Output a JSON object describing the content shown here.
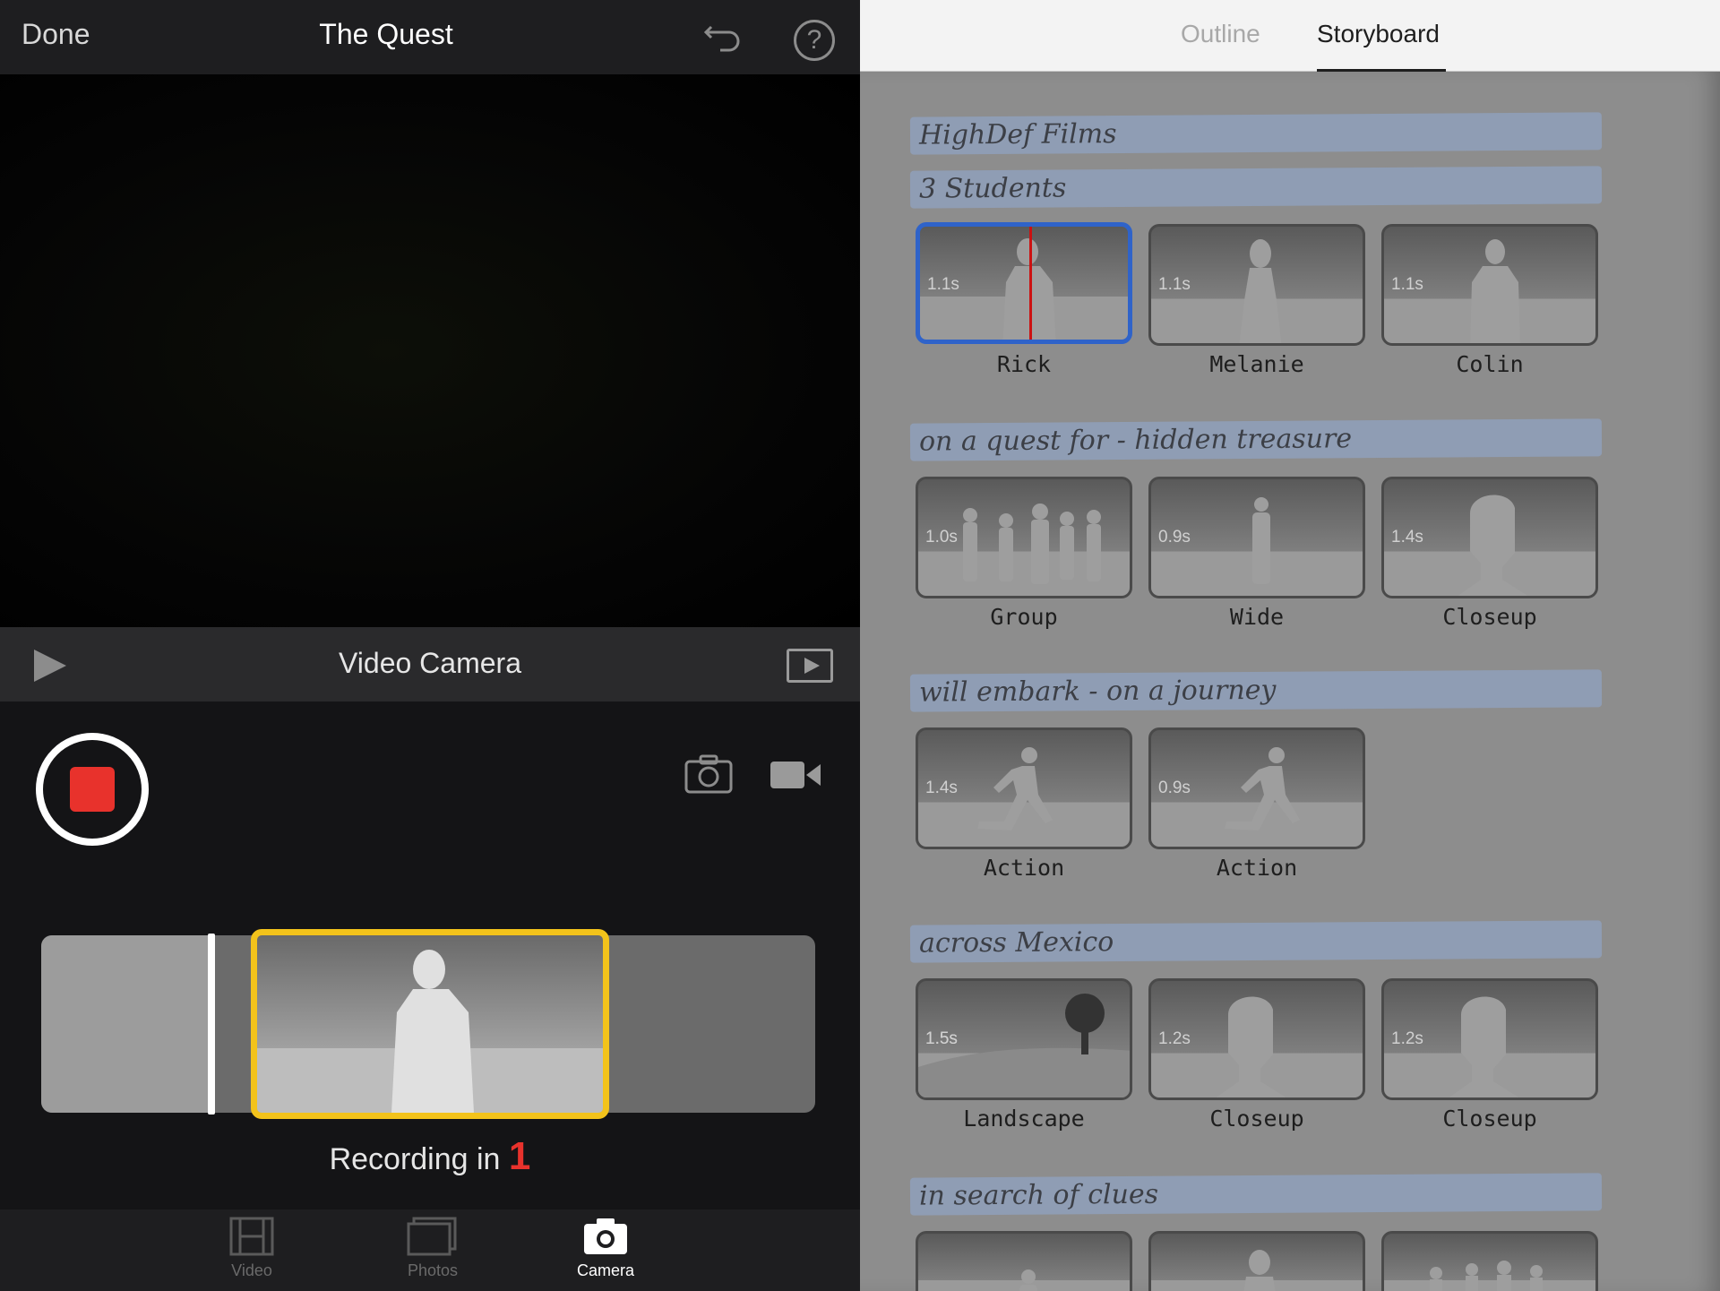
{
  "editor": {
    "done_label": "Done",
    "title": "The Quest",
    "undo_icon": "undo-arrow",
    "help_glyph": "?"
  },
  "camera_bar": {
    "label": "Video Camera"
  },
  "recording": {
    "prefix": "Recording in ",
    "countdown": "1",
    "accent": "#e8322c"
  },
  "clip_strip": {
    "highlight_color": "#f3c31b"
  },
  "tabs": [
    {
      "label": "Video",
      "icon": "film-icon",
      "active": false
    },
    {
      "label": "Photos",
      "icon": "photos-icon",
      "active": false
    },
    {
      "label": "Camera",
      "icon": "camera-icon",
      "active": true
    }
  ],
  "storyboard_tabs": {
    "outline": "Outline",
    "storyboard": "Storyboard",
    "active": "Storyboard"
  },
  "storyboard": {
    "selection_color": "#2f63c9",
    "sections": [
      {
        "headlines": [
          "HighDef Films",
          "3 Students"
        ],
        "shots": [
          {
            "duration": "1.1s",
            "caption": "Rick",
            "selected": true
          },
          {
            "duration": "1.1s",
            "caption": "Melanie"
          },
          {
            "duration": "1.1s",
            "caption": "Colin"
          }
        ]
      },
      {
        "headlines": [
          "on a quest for - hidden treasure"
        ],
        "shots": [
          {
            "duration": "1.0s",
            "caption": "Group"
          },
          {
            "duration": "0.9s",
            "caption": "Wide"
          },
          {
            "duration": "1.4s",
            "caption": "Closeup"
          }
        ]
      },
      {
        "headlines": [
          "will embark - on a journey"
        ],
        "shots": [
          {
            "duration": "1.4s",
            "caption": "Action"
          },
          {
            "duration": "0.9s",
            "caption": "Action"
          }
        ]
      },
      {
        "headlines": [
          "across Mexico"
        ],
        "shots": [
          {
            "duration": "1.5s",
            "caption": "Landscape"
          },
          {
            "duration": "1.2s",
            "caption": "Closeup"
          },
          {
            "duration": "1.2s",
            "caption": "Closeup"
          }
        ]
      },
      {
        "headlines": [
          "in search of clues"
        ],
        "shots": []
      }
    ]
  }
}
